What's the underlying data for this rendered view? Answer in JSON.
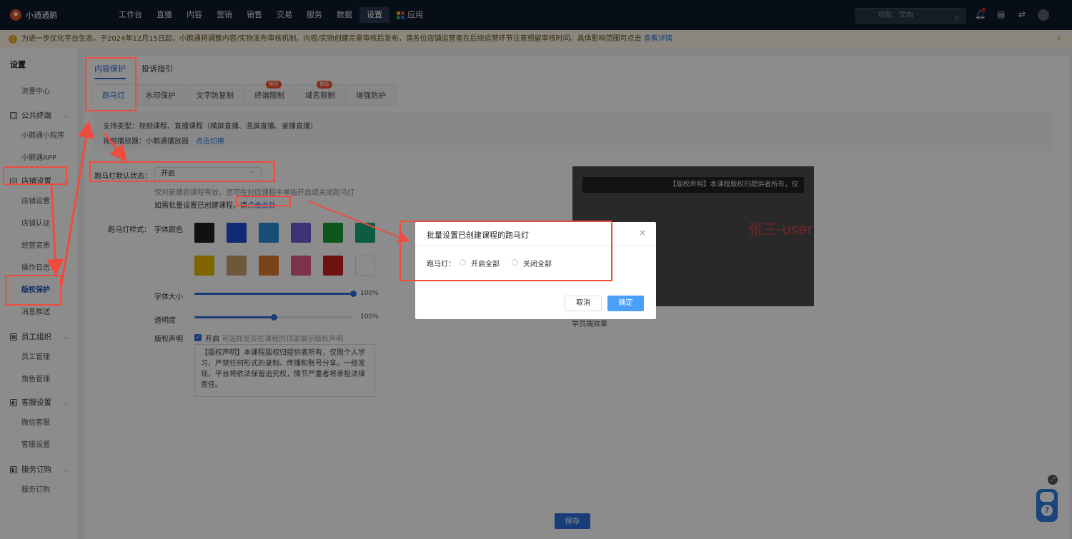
{
  "app": {
    "name": "小通通鹅"
  },
  "nav": {
    "items": [
      "工作台",
      "直播",
      "内容",
      "营销",
      "销售",
      "交易",
      "服务",
      "数据",
      "设置"
    ],
    "active_index": 8,
    "app_label": "应用",
    "search_placeholder": "功能、文档"
  },
  "notice": {
    "text": "为进一步优化平台生态，于2024年12月15日起，小鹅通将调整内容/实物发布审核机制。内容/实物创建完需审核后发布，请各位店铺运营者在后续运营环节注意预留审核时间。具体影响范围可点击",
    "link": "查看详情",
    "close": "×"
  },
  "sidebar": {
    "title": "设置",
    "flow_center": "流量中心",
    "groups": [
      {
        "label": "公共终端",
        "items": [
          "小鹅通小程序",
          "小鹅通APP"
        ]
      },
      {
        "label": "店铺设置",
        "items": [
          "店铺设置",
          "店铺认证",
          "经营资质",
          "操作日志",
          "版权保护",
          "消息推送"
        ]
      },
      {
        "label": "员工组织",
        "items": [
          "员工管理",
          "角色管理"
        ]
      },
      {
        "label": "客服设置",
        "items": [
          "微信客服",
          "客服设置"
        ]
      },
      {
        "label": "服务订购",
        "items": [
          "服务订购"
        ]
      }
    ],
    "active_item": "版权保护"
  },
  "tabs_primary": [
    "内容保护",
    "投诉指引"
  ],
  "tabs_secondary": [
    {
      "label": "跑马灯",
      "badge": ""
    },
    {
      "label": "水印保护",
      "badge": ""
    },
    {
      "label": "文字防复制",
      "badge": ""
    },
    {
      "label": "终端限制",
      "badge": "推荐"
    },
    {
      "label": "域名限制",
      "badge": "推荐"
    },
    {
      "label": "增强防护",
      "badge": ""
    }
  ],
  "info": {
    "support_types": "支持类型：视频课程、直播课程（横屏直播、竖屏直播、录播直播）",
    "player_label": "视频播放器：小鹅通播放器",
    "player_link": "点击切换"
  },
  "form": {
    "default_state_label": "跑马灯默认状态：",
    "default_state_value": "开启",
    "hint1": "仅对新建的课程有效，您可在对应课程中单独开启或关闭跑马灯",
    "hint2": "如需批量设置已创建课程，请",
    "hint2_link": "点击此处",
    "style_label": "跑马灯样式：",
    "font_color_label": "字体颜色",
    "colors": [
      "#1f1f1f",
      "#1d4fd6",
      "#2a8ed8",
      "#6d5fcf",
      "#15a130",
      "#16a87a",
      "#e6b800",
      "#c8a06e",
      "#e07a2a",
      "#e25e86",
      "#cc1f1f",
      "#ffffff"
    ],
    "font_size_label": "字体大小",
    "font_size_value": "100%",
    "font_size_fraction": 1.0,
    "opacity_label": "透明度",
    "opacity_value": "100%",
    "opacity_fraction": 0.5,
    "copyright_label": "版权声明",
    "copyright_checkbox": "开启",
    "copyright_hint": "可选择是否在课程的顶部展示版权声明",
    "copyright_text": "【版权声明】本课程版权归提供者所有，仅限个人学习，严禁任何形式的录制、传播和账号分享。一经发现，平台将依法保留追究权，情节严重者将承担法律责任。"
  },
  "preview": {
    "bar_text": "【版权声明】本课程版权归提供者所有，仅",
    "marquee_text": "张三-user",
    "caption": "学员端效果"
  },
  "save_label": "保存",
  "modal": {
    "title": "批量设置已创建课程的跑马灯",
    "close": "×",
    "row_label": "跑马灯：",
    "option_on": "开启全部",
    "option_off": "关闭全部",
    "cancel": "取消",
    "ok": "确定"
  }
}
